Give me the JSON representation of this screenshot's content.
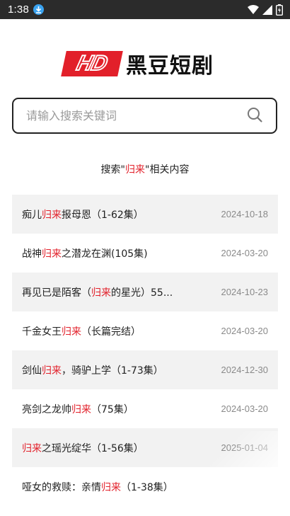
{
  "status_bar": {
    "time": "1:38",
    "icons": [
      "download-icon",
      "wifi-icon",
      "signal-icon",
      "battery-icon"
    ]
  },
  "logo": {
    "badge": "HD",
    "name": "黑豆短剧",
    "brand_color": "#e2202a"
  },
  "search": {
    "placeholder": "请输入搜索关键词",
    "value": ""
  },
  "results_heading": {
    "prefix": "搜索\"",
    "keyword": "归来",
    "suffix": "\"相关内容"
  },
  "results": [
    {
      "before": "痴儿",
      "keyword": "归来",
      "after": "报母恩（1-62集）",
      "date": "2024-10-18"
    },
    {
      "before": "战神",
      "keyword": "归来",
      "after": "之潜龙在渊(105集)",
      "date": "2024-03-20"
    },
    {
      "before": "再见已是陌客（",
      "keyword": "归来",
      "after": "的星光）55...",
      "date": "2024-10-23"
    },
    {
      "before": "千金女王",
      "keyword": "归来",
      "after": "（长篇完结）",
      "date": "2024-03-20"
    },
    {
      "before": "剑仙",
      "keyword": "归来",
      "after": "，骑驴上学（1-73集）",
      "date": "2024-12-30"
    },
    {
      "before": "亮剑之龙帅",
      "keyword": "归来",
      "after": "（75集）",
      "date": "2024-03-20"
    },
    {
      "before": "",
      "keyword": "归来",
      "after": "之瑶光绽华（1-56集）",
      "date": "2025-01-04"
    },
    {
      "before": "哑女的救赎：亲情",
      "keyword": "归来",
      "after": "（1-38集）",
      "date": ""
    }
  ]
}
